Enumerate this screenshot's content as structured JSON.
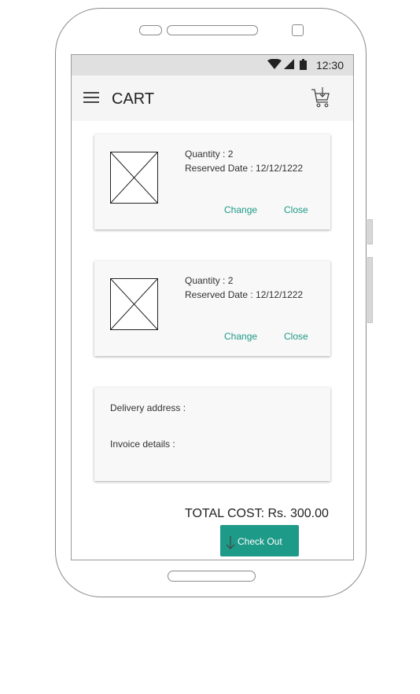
{
  "statusbar": {
    "time": "12:30",
    "icons": [
      "wifi-icon",
      "signal-icon",
      "battery-icon"
    ]
  },
  "appbar": {
    "title": "CART",
    "icons": [
      "menu-icon",
      "cart-icon"
    ]
  },
  "cart_items": [
    {
      "quantity_text": "Quantity : 2",
      "reserved_date_text": "Reserved Date : 12/12/1222",
      "change_label": "Change",
      "close_label": "Close"
    },
    {
      "quantity_text": "Quantity : 2",
      "reserved_date_text": "Reserved Date : 12/12/1222",
      "change_label": "Change",
      "close_label": "Close"
    }
  ],
  "details": {
    "delivery_label": "Delivery address :",
    "invoice_label": "Invoice details :"
  },
  "total": {
    "text": "TOTAL COST: Rs. 300.00"
  },
  "checkout": {
    "label": "Check Out",
    "icon": "arrow-down-icon"
  },
  "colors": {
    "accent": "#1e9a88",
    "statusbar": "#e0e0e0",
    "appbar": "#f5f5f5",
    "card": "#f8f8f8"
  }
}
